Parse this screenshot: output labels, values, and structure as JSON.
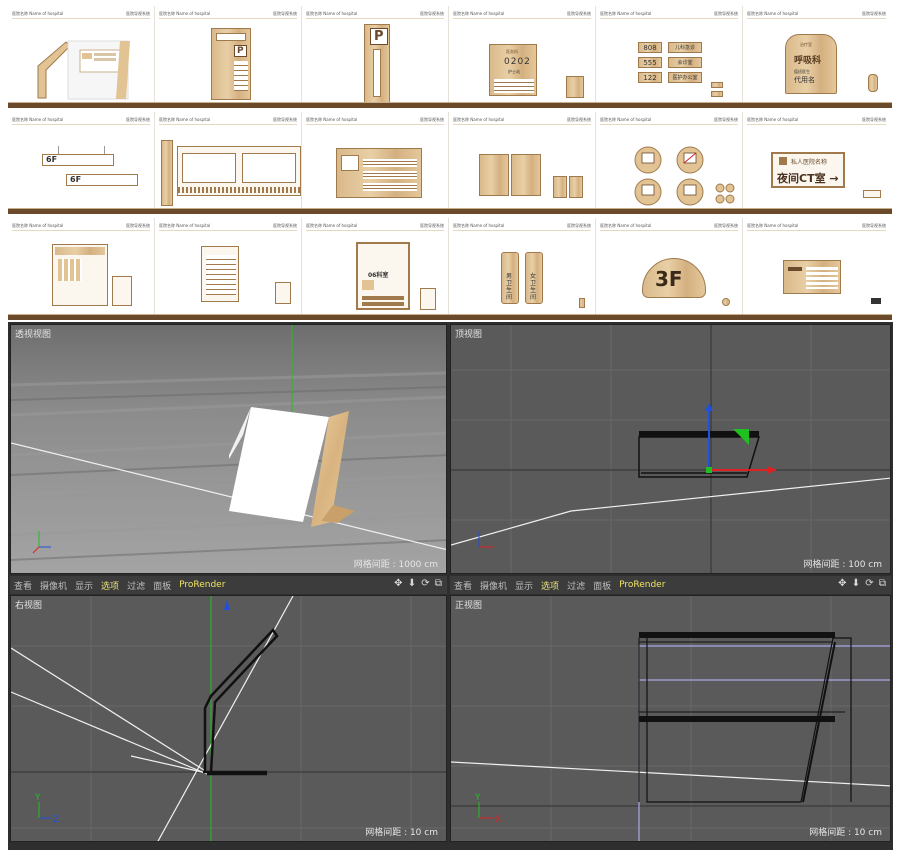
{
  "catalog": {
    "cell_header_left": "医院名称 Name of hospital",
    "cell_header_right": "医院导视系统",
    "row1": {
      "parking": "P",
      "room_number": "0202",
      "room_title": "医务科",
      "room_subtitle": "护士站",
      "dept_numbers": [
        "808",
        "555",
        "122"
      ],
      "dept_names": [
        "儿科急诊",
        "会诊室",
        "医护办公室"
      ],
      "respiratory_tag": "治疗室",
      "respiratory_title": "呼吸科",
      "respiratory_sub": "值班医生",
      "respiratory_name": "代用名"
    },
    "row2": {
      "floor_top": "6F",
      "floor_bottom": "6F",
      "ct_logo": "私人医院名称",
      "ct_label": "夜间CT室",
      "ct_arrow": "→"
    },
    "row3": {
      "bulletin_title": "06科室",
      "floor_big": "3F",
      "restroom_left": "男卫生间",
      "restroom_right": "女卫生间"
    }
  },
  "viewports": {
    "perspective": {
      "label": "透视视图",
      "grid": "网格间距 : 1000 cm"
    },
    "top": {
      "label": "顶视图",
      "grid": "网格间距 : 100 cm"
    },
    "right": {
      "label": "右视图",
      "grid": "网格间距 : 10 cm"
    },
    "front": {
      "label": "正视图",
      "grid": "网格间距 : 10 cm"
    }
  },
  "menus": {
    "left": [
      "查看",
      "摄像机",
      "显示",
      "选项",
      "过滤",
      "面板",
      "ProRender"
    ],
    "right": [
      "查看",
      "摄像机",
      "显示",
      "选项",
      "过滤",
      "面板",
      "ProRender"
    ],
    "tools": "✥ ⬇ ⟳ ⧉"
  },
  "axes": {
    "y": "Y",
    "z": "Z",
    "x": "X"
  },
  "colors": {
    "wood": "#e2c394",
    "brand_brown": "#6b4a2b",
    "viewport_bg": "#5a5a5a",
    "menubar_bg": "#3c3c3c",
    "active_menu": "#e8e27a",
    "axis_x": "#e02020",
    "axis_y": "#20c020",
    "axis_z": "#2050e0"
  }
}
